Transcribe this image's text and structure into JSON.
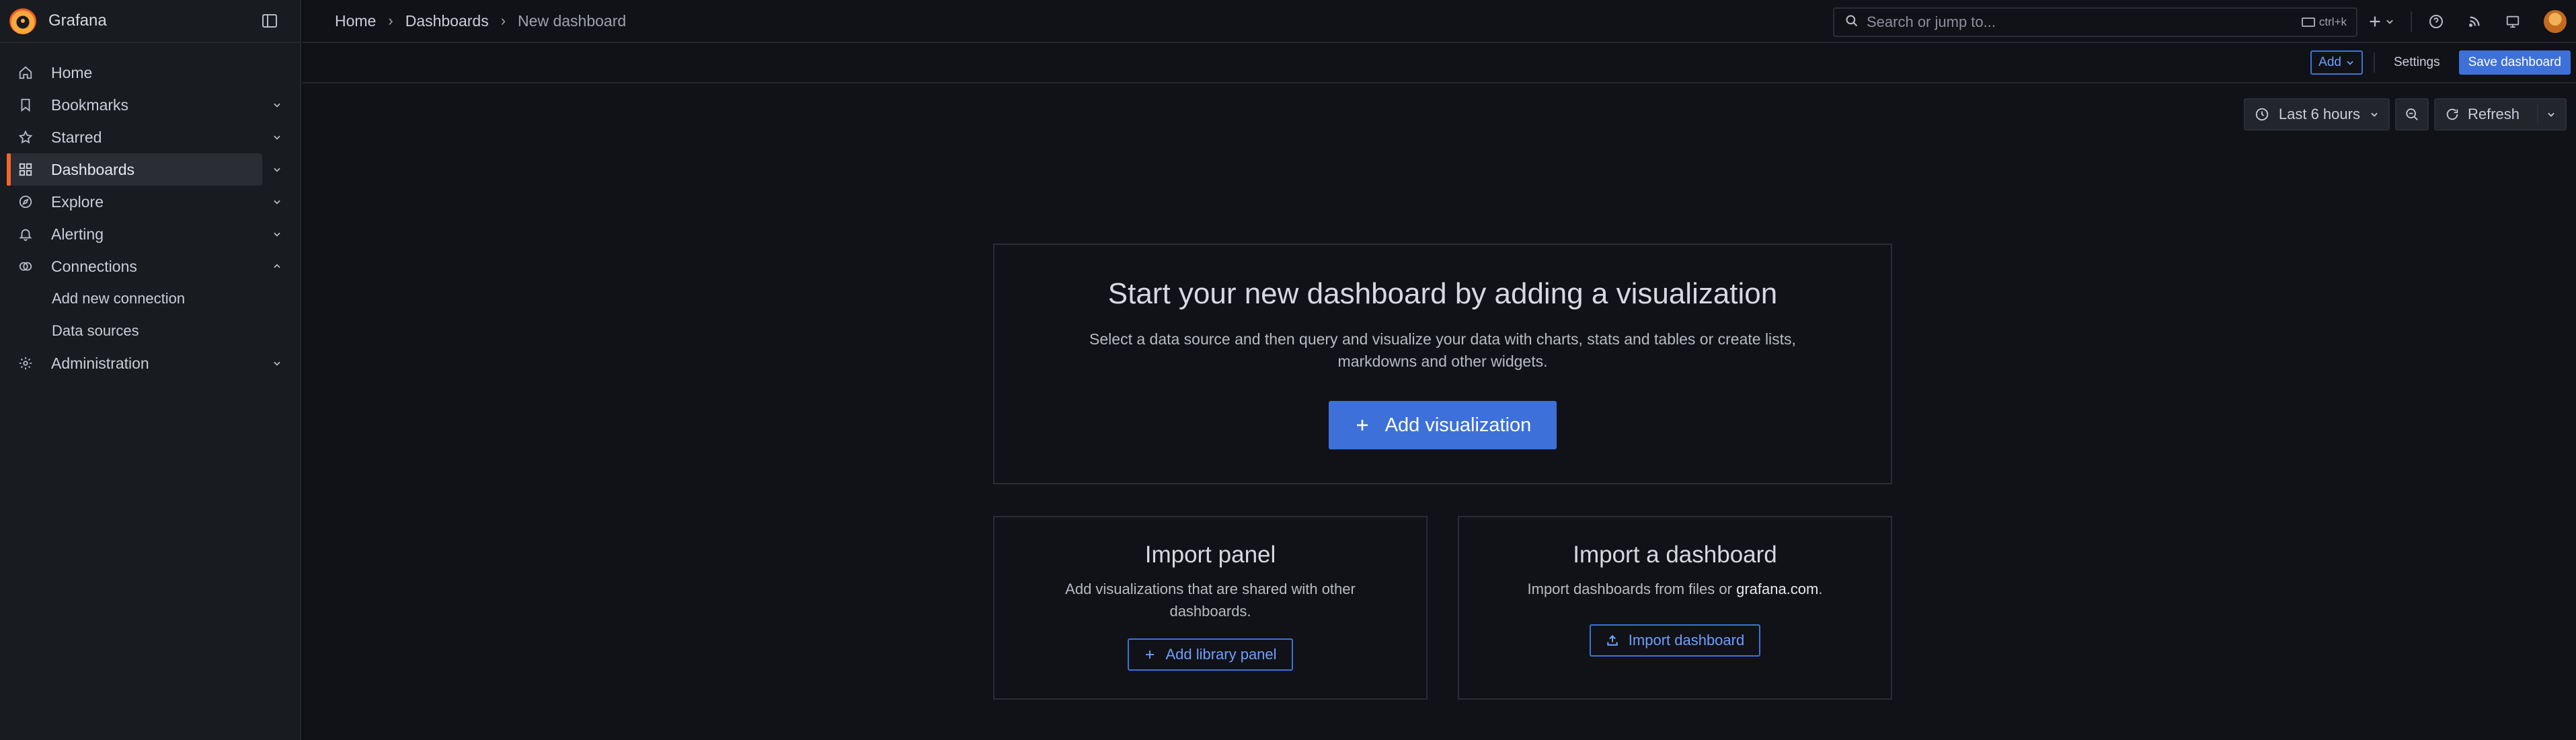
{
  "app": {
    "name": "Grafana"
  },
  "sidebar": {
    "items": [
      {
        "label": "Home",
        "icon": "home-icon"
      },
      {
        "label": "Bookmarks",
        "icon": "bookmark-icon"
      },
      {
        "label": "Starred",
        "icon": "star-icon"
      },
      {
        "label": "Dashboards",
        "icon": "apps-icon",
        "active": true
      },
      {
        "label": "Explore",
        "icon": "compass-icon"
      },
      {
        "label": "Alerting",
        "icon": "bell-icon"
      },
      {
        "label": "Connections",
        "icon": "link-icon",
        "expanded": true
      },
      {
        "label": "Administration",
        "icon": "gear-icon"
      }
    ],
    "subitems": [
      {
        "label": "Add new connection"
      },
      {
        "label": "Data sources"
      }
    ]
  },
  "breadcrumb": [
    "Home",
    "Dashboards",
    "New dashboard"
  ],
  "search": {
    "placeholder": "Search or jump to...",
    "shortcut": "ctrl+k"
  },
  "toolbar": {
    "add_label": "Add",
    "settings_label": "Settings",
    "save_label": "Save dashboard"
  },
  "time": {
    "range_label": "Last 6 hours",
    "refresh_label": "Refresh"
  },
  "main_card": {
    "title": "Start your new dashboard by adding a visualization",
    "description": "Select a data source and then query and visualize your data with charts, stats and tables or create lists, markdowns and other widgets.",
    "button": "Add visualization"
  },
  "import_panel": {
    "title": "Import panel",
    "description": "Add visualizations that are shared with other dashboards.",
    "button": "Add library panel"
  },
  "import_dashboard": {
    "title": "Import a dashboard",
    "description_prefix": "Import dashboards from files or ",
    "description_link": "grafana.com",
    "description_suffix": ".",
    "button": "Import dashboard"
  },
  "colors": {
    "accent": "#3d71d9",
    "brand": "#f5642b",
    "background": "#111217"
  }
}
